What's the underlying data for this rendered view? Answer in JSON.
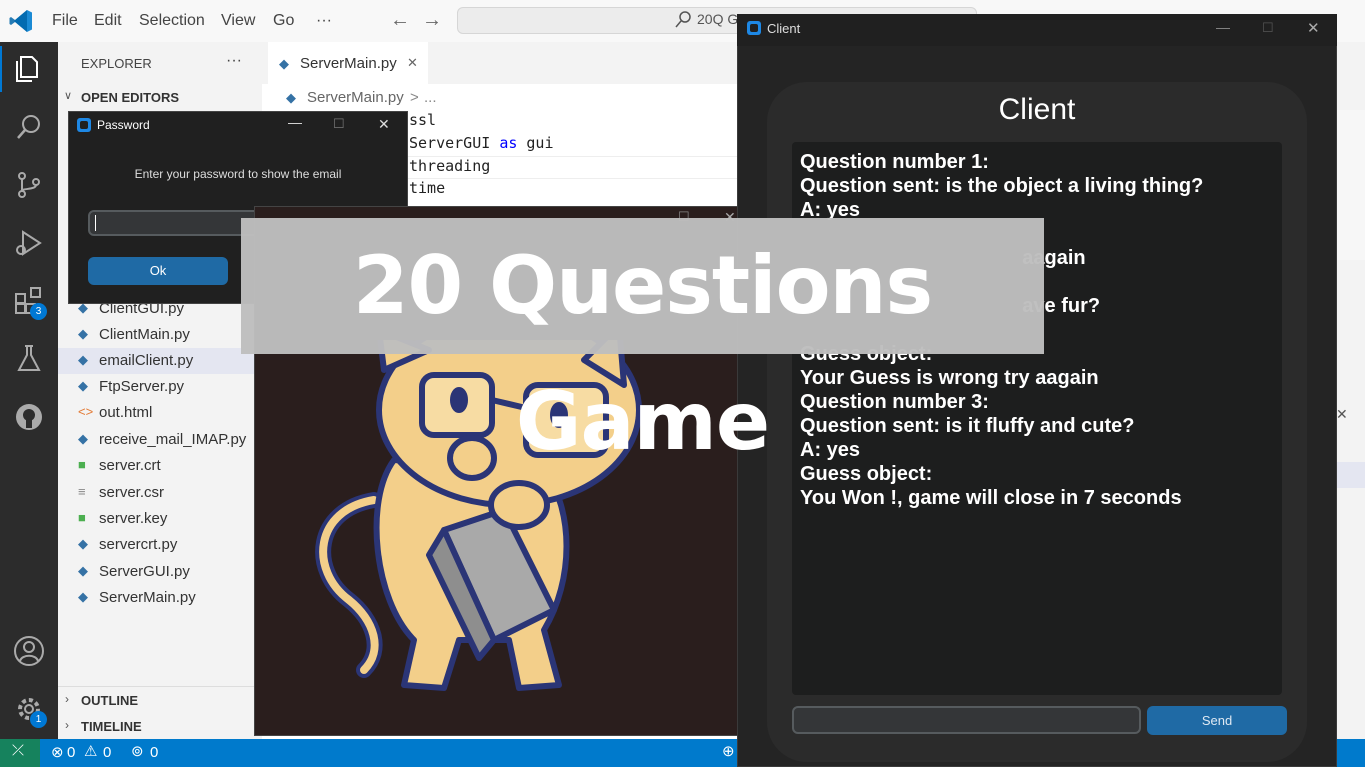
{
  "vscode": {
    "menu": [
      "File",
      "Edit",
      "Selection",
      "View",
      "Go",
      "···"
    ],
    "command_center": "20Q G",
    "activity_badges": {
      "extensions": "3",
      "settings": "1"
    },
    "explorer": {
      "title": "EXPLORER",
      "more": "···",
      "open_editors": "OPEN EDITORS",
      "files": [
        {
          "name": "ClientGUI.py",
          "icon": "python-icon"
        },
        {
          "name": "ClientMain.py",
          "icon": "python-icon"
        },
        {
          "name": "emailClient.py",
          "icon": "python-icon"
        },
        {
          "name": "FtpServer.py",
          "icon": "python-icon"
        },
        {
          "name": "out.html",
          "icon": "html-icon"
        },
        {
          "name": "receive_mail_IMAP.py",
          "icon": "python-icon"
        },
        {
          "name": "server.crt",
          "icon": "lock-icon"
        },
        {
          "name": "server.csr",
          "icon": "lines-icon"
        },
        {
          "name": "server.key",
          "icon": "lock-icon"
        },
        {
          "name": "servercrt.py",
          "icon": "python-icon"
        },
        {
          "name": "ServerGUI.py",
          "icon": "python-icon"
        },
        {
          "name": "ServerMain.py",
          "icon": "python-icon"
        }
      ],
      "outline": "OUTLINE",
      "timeline": "TIMELINE"
    },
    "tab": {
      "label": "ServerMain.py",
      "close": "✕"
    },
    "breadcrumb": {
      "file": "ServerMain.py",
      "sep": ">",
      "more": "..."
    },
    "code_lines": [
      {
        "pre": "ssl",
        "kw": "",
        "post": ""
      },
      {
        "pre": "ServerGUI ",
        "kw": "as",
        "post": " gui"
      },
      {
        "pre": "threading",
        "kw": "",
        "post": ""
      },
      {
        "pre": "time",
        "kw": "",
        "post": ""
      }
    ],
    "statusbar": {
      "errors": "0",
      "warnings": "0",
      "ports": "0"
    }
  },
  "password_dialog": {
    "title": "Password",
    "message": "Enter your password to show the email",
    "input_value": "",
    "ok_label": "Ok"
  },
  "client": {
    "window_title": "Client",
    "heading": "Client",
    "log_lines": [
      "Question number 1:",
      "Question sent: is the object a living thing?",
      "A: yes",
      "",
      "                                        aagain",
      "",
      "                                        ave fur?",
      "",
      "Guess object:",
      "Your Guess is wrong try aagain",
      "Question number 3:",
      "Question sent: is it fluffy and cute?",
      "A: yes",
      "Guess object:",
      "You Won !, game will close in 7 seconds"
    ],
    "input_value": "",
    "send_label": "Send"
  },
  "banner": {
    "text": "20 Questions Game"
  },
  "colors": {
    "accent": "#1f6aa5",
    "statusbar": "#007acc",
    "vscode_blue": "#0078d4"
  }
}
